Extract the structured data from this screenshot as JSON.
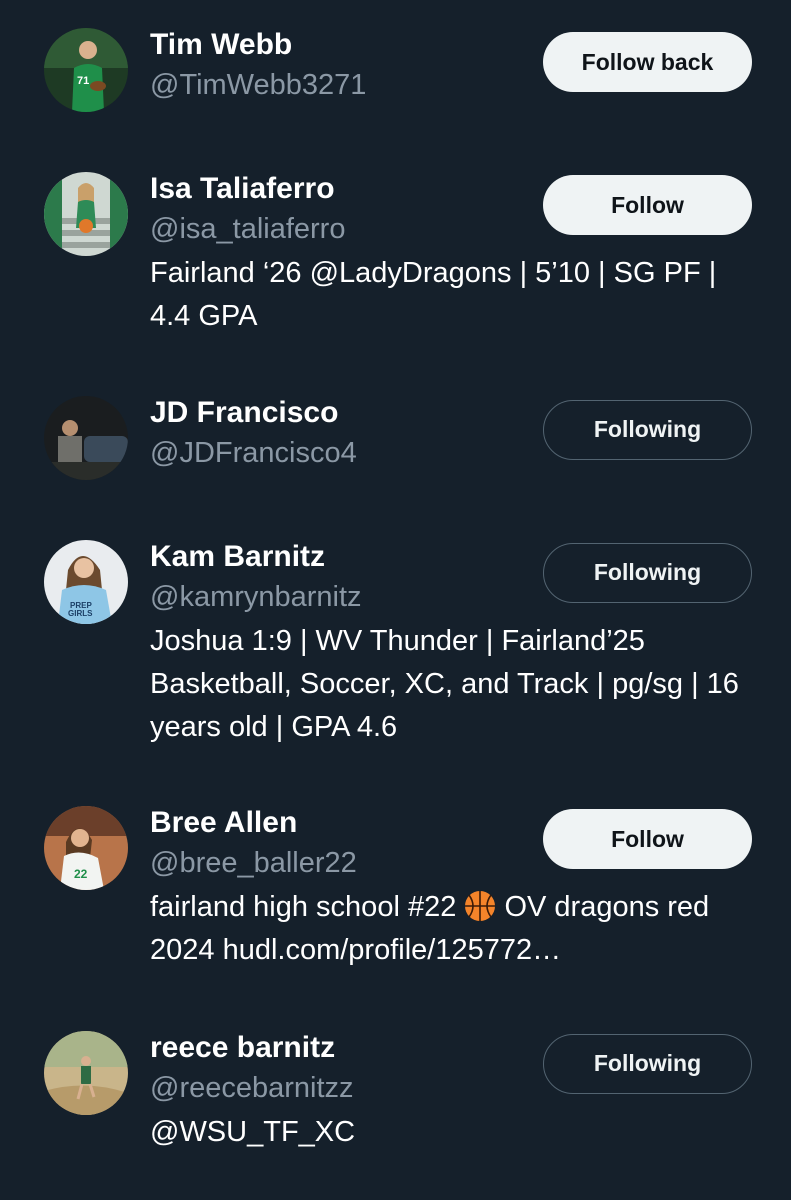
{
  "users": [
    {
      "name": "Tim Webb",
      "handle": "@TimWebb3271",
      "button": "Follow back"
    },
    {
      "name": "Isa Taliaferro",
      "handle": "@isa_taliaferro",
      "bio": "Fairland ‘26 @LadyDragons | 5’10 | SG PF | 4.4 GPA",
      "button": "Follow"
    },
    {
      "name": "JD Francisco",
      "handle": "@JDFrancisco4",
      "button": "Following"
    },
    {
      "name": "Kam Barnitz",
      "handle": "@kamrynbarnitz",
      "bio": "Joshua 1:9 | WV Thunder | Fairland’25 Basketball, Soccer, XC, and Track | pg/sg | 16 years old | GPA 4.6",
      "button": "Following"
    },
    {
      "name": "Bree Allen",
      "handle": "@bree_baller22",
      "bio_before_emoji": "fairland high school #22 ",
      "bio_emoji_icon": "basketball-icon",
      "bio_after_emoji": " OV dragons red 2024 hudl.com/profile/125772…",
      "button": "Follow"
    },
    {
      "name": "reece barnitz",
      "handle": "@reecebarnitzz",
      "bio": "@WSU_TF_XC",
      "button": "Following"
    }
  ],
  "colors": {
    "background": "#15202b",
    "primary_text": "#ffffff",
    "secondary_text": "#8b98a5",
    "light_button_bg": "#eff3f4",
    "light_button_text": "#0f1419",
    "outline_border": "#536471"
  }
}
